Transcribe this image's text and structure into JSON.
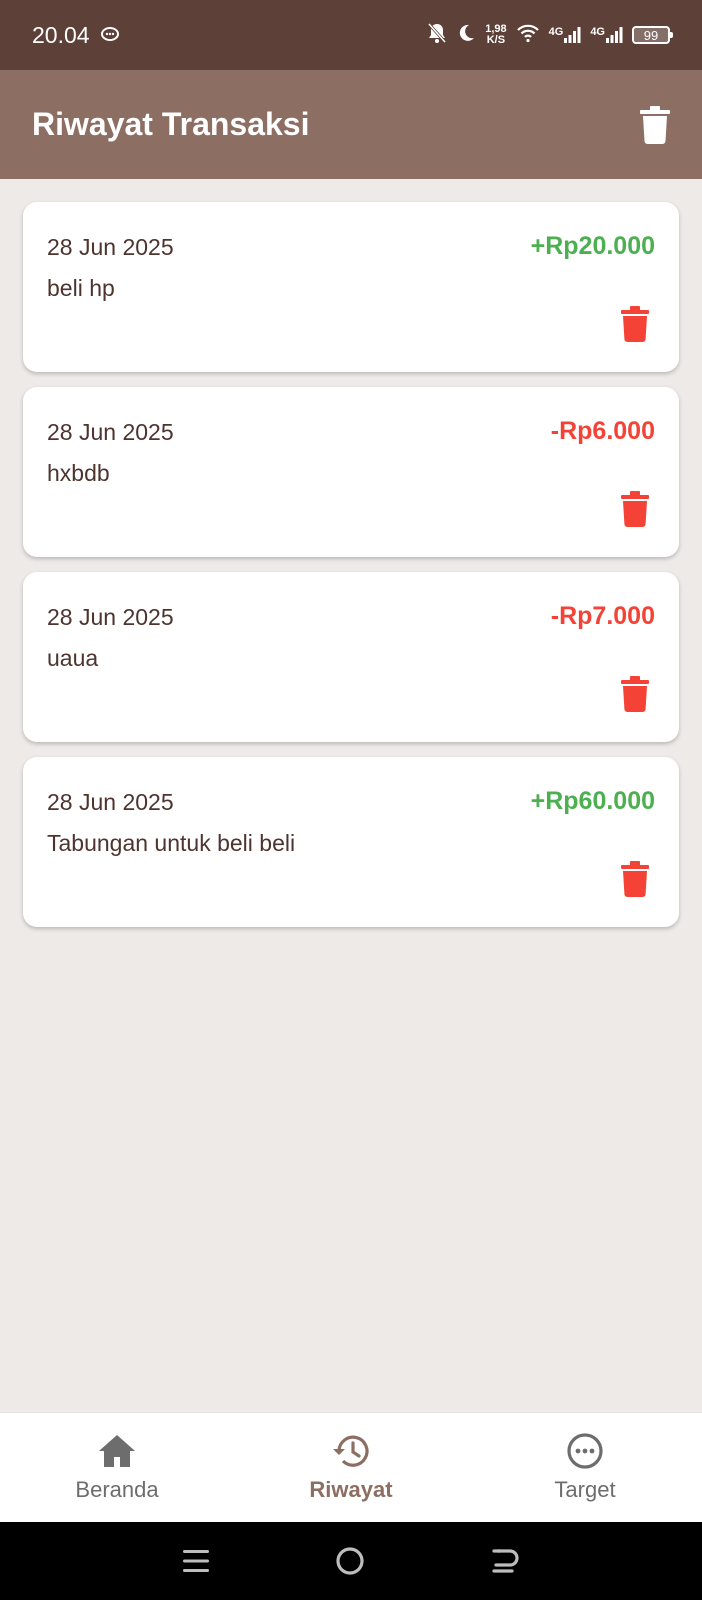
{
  "status_bar": {
    "time": "20.04",
    "net_speed_value": "1,98",
    "net_speed_unit": "K/S",
    "sim1_label": "4G",
    "sim2_label": "4G",
    "battery_level": "99"
  },
  "app_bar": {
    "title": "Riwayat Transaksi",
    "delete_all_icon": "trash-icon"
  },
  "transactions": [
    {
      "date": "28 Jun 2025",
      "description": "beli hp",
      "amount": "+Rp20.000",
      "type": "income"
    },
    {
      "date": "28 Jun 2025",
      "description": "hxbdb",
      "amount": "-Rp6.000",
      "type": "expense"
    },
    {
      "date": "28 Jun 2025",
      "description": "uaua",
      "amount": "-Rp7.000",
      "type": "expense"
    },
    {
      "date": "28 Jun 2025",
      "description": "Tabungan untuk beli beli",
      "amount": "+Rp60.000",
      "type": "income"
    }
  ],
  "bottom_nav": {
    "items": [
      {
        "label": "Beranda",
        "icon": "home-icon",
        "active": false
      },
      {
        "label": "Riwayat",
        "icon": "history-icon",
        "active": true
      },
      {
        "label": "Target",
        "icon": "more-icon",
        "active": false
      }
    ]
  },
  "colors": {
    "status_bar": "#5D4037",
    "app_bar": "#8D6E63",
    "income": "#4CAF50",
    "expense": "#F44336",
    "delete_icon": "#F44336",
    "active_nav": "#8D6E63",
    "background": "#EEEAE8"
  }
}
